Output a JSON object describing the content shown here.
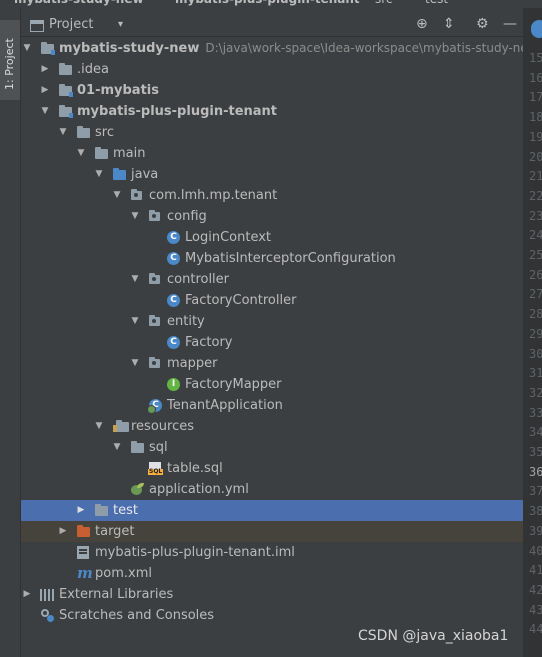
{
  "top_breadcrumb": [
    "mybatis-study-new",
    "mybatis-plus-plugin-tenant",
    "src",
    "test"
  ],
  "side_strip": {
    "tab_label": "1: Project"
  },
  "panel": {
    "title": "Project",
    "icons": [
      "target-icon",
      "collapse-icon",
      "gear-icon",
      "minimize-icon"
    ]
  },
  "tree": [
    {
      "label": "mybatis-study-new",
      "path": "D:\\java\\work-space\\Idea-workspace\\mybatis-study-new"
    },
    {
      "label": ".idea"
    },
    {
      "label": "01-mybatis"
    },
    {
      "label": "mybatis-plus-plugin-tenant"
    },
    {
      "label": "src"
    },
    {
      "label": "main"
    },
    {
      "label": "java"
    },
    {
      "label": "com.lmh.mp.tenant"
    },
    {
      "label": "config"
    },
    {
      "label": "LoginContext"
    },
    {
      "label": "MybatisInterceptorConfiguration"
    },
    {
      "label": "controller"
    },
    {
      "label": "FactoryController"
    },
    {
      "label": "entity"
    },
    {
      "label": "Factory"
    },
    {
      "label": "mapper"
    },
    {
      "label": "FactoryMapper"
    },
    {
      "label": "TenantApplication"
    },
    {
      "label": "resources"
    },
    {
      "label": "sql"
    },
    {
      "label": "table.sql"
    },
    {
      "label": "application.yml"
    },
    {
      "label": "test"
    },
    {
      "label": "target"
    },
    {
      "label": "mybatis-plus-plugin-tenant.iml"
    },
    {
      "label": "pom.xml"
    },
    {
      "label": "External Libraries"
    },
    {
      "label": "Scratches and Consoles"
    }
  ],
  "line_numbers": [
    "15",
    "16",
    "17",
    "18",
    "19",
    "20",
    "21",
    "22",
    "23",
    "24",
    "25",
    "26",
    "27",
    "28",
    "29",
    "30",
    "31",
    "32",
    "33",
    "34",
    "35",
    "36",
    "37",
    "38",
    "39",
    "40",
    "41",
    "42",
    "43",
    "44"
  ],
  "watermark": "CSDN @java_xiaoba1"
}
